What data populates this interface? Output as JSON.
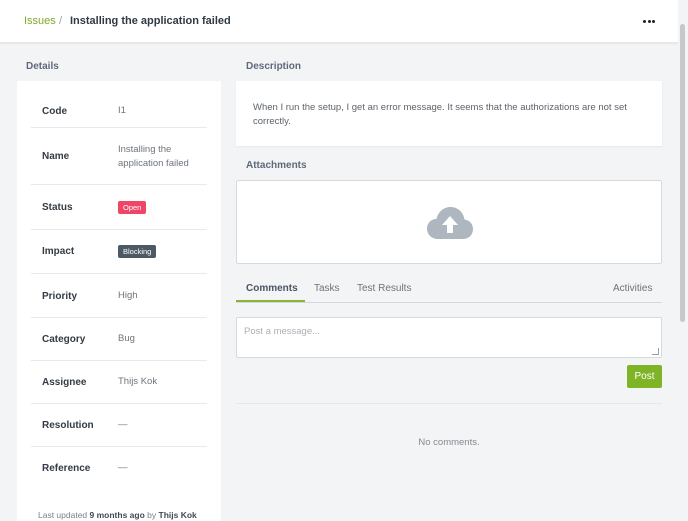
{
  "breadcrumb": {
    "root": "Issues",
    "separator": "/",
    "current": "Installing the application failed"
  },
  "header": {
    "more_icon": "ellipsis-icon"
  },
  "details": {
    "title": "Details",
    "rows": [
      {
        "label": "Code",
        "value": "I1"
      },
      {
        "label": "Name",
        "value": "Installing the application failed"
      },
      {
        "label": "Status",
        "value": "Open"
      },
      {
        "label": "Impact",
        "value": "Blocking"
      },
      {
        "label": "Priority",
        "value": "High"
      },
      {
        "label": "Category",
        "value": "Bug"
      },
      {
        "label": "Assignee",
        "value": "Thijs Kok"
      },
      {
        "label": "Resolution",
        "value": "—"
      },
      {
        "label": "Reference",
        "value": "—"
      }
    ],
    "footer": {
      "prefix": "Last updated",
      "when": "9 months ago",
      "by_word": "by",
      "by": "Thijs Kok"
    }
  },
  "description": {
    "title": "Description",
    "text": "When I run the setup, I get an error message. It seems that the authorizations are not set correctly."
  },
  "attachments": {
    "title": "Attachments",
    "icon": "cloud-upload-icon"
  },
  "tabs": {
    "comments": "Comments",
    "tasks": "Tasks",
    "test_results": "Test Results",
    "activities": "Activities"
  },
  "comment_form": {
    "placeholder": "Post a message...",
    "post_label": "Post"
  },
  "comments": {
    "empty": "No comments."
  },
  "colors": {
    "accent": "#7fb426",
    "status_open": "#ef4668",
    "impact_blocking": "#4d5a66",
    "breadcrumb_link": "#7fa82a"
  }
}
